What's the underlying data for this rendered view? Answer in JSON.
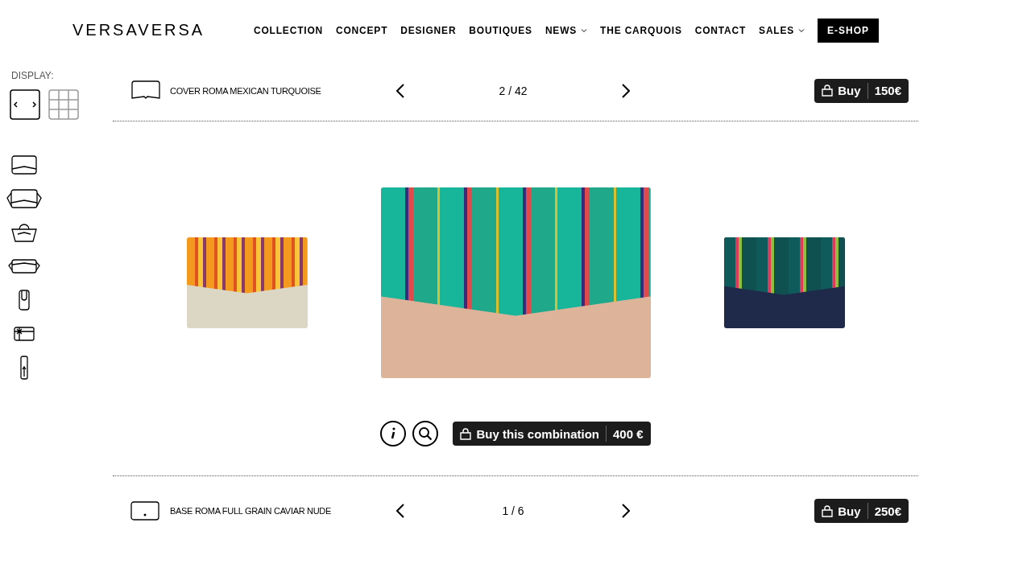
{
  "header": {
    "logo": "VERSAVERSA",
    "nav": [
      {
        "label": "COLLECTION",
        "has_dropdown": false
      },
      {
        "label": "CONCEPT",
        "has_dropdown": false
      },
      {
        "label": "DESIGNER",
        "has_dropdown": false
      },
      {
        "label": "BOUTIQUES",
        "has_dropdown": false
      },
      {
        "label": "NEWS",
        "has_dropdown": true
      },
      {
        "label": "THE CARQUOIS",
        "has_dropdown": false
      },
      {
        "label": "CONTACT",
        "has_dropdown": false
      },
      {
        "label": "SALES",
        "has_dropdown": true
      }
    ],
    "eshop": "E-SHOP"
  },
  "sidebar": {
    "display_label": "DISPLAY:",
    "modes": [
      {
        "kind": "carousel",
        "selected": true
      },
      {
        "kind": "grid",
        "selected": false
      }
    ]
  },
  "cover": {
    "kind": "cover",
    "name": "COVER ROMA MEXICAN TURQUOISE",
    "counter": "2 / 42",
    "buy_label": "Buy",
    "price": "150€"
  },
  "combination": {
    "buy_label": "Buy this combination",
    "price": "400 €"
  },
  "base": {
    "kind": "base",
    "name": "BASE ROMA FULL GRAIN CAVIAR NUDE",
    "counter": "1 / 6",
    "buy_label": "Buy",
    "price": "250€"
  }
}
